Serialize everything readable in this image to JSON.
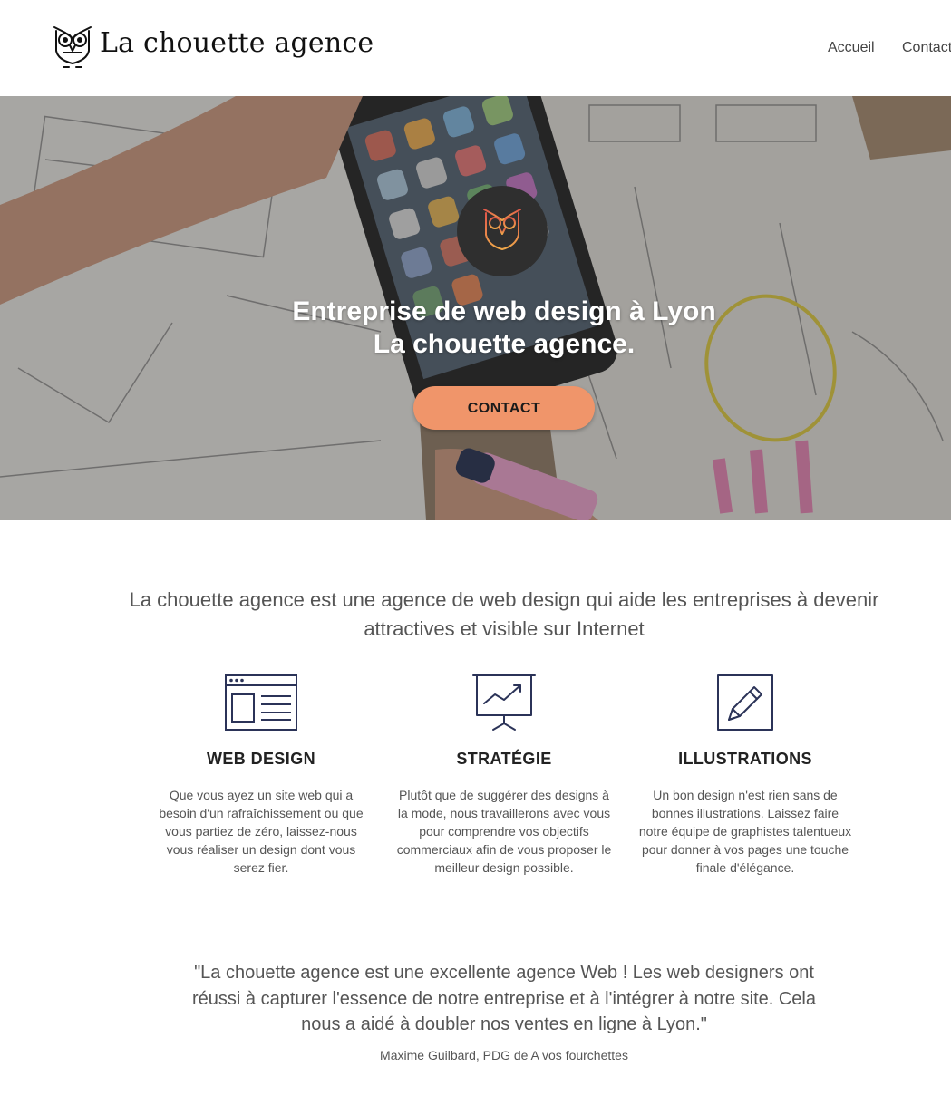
{
  "header": {
    "brand": "La chouette agence",
    "nav": [
      "Accueil",
      "Contact"
    ]
  },
  "hero": {
    "title_line1": "Entreprise de web design à Lyon",
    "title_line2": "La chouette agence.",
    "cta_label": "CONTACT"
  },
  "intro": {
    "text": "La chouette agence est une agence de web design qui aide les entreprises à devenir attractives et visible sur Internet"
  },
  "services": [
    {
      "icon": "browser-window-icon",
      "title": "WEB DESIGN",
      "text": "Que vous ayez un site web qui a besoin d'un rafraîchissement ou que vous partiez de zéro, laissez-nous vous réaliser un design dont vous serez fier."
    },
    {
      "icon": "presentation-chart-icon",
      "title": "STRATÉGIE",
      "text": "Plutôt que de suggérer des designs à la mode, nous travaillerons avec vous pour comprendre vos objectifs commerciaux afin de vous proposer le meilleur design possible."
    },
    {
      "icon": "pencil-square-icon",
      "title": "ILLUSTRATIONS",
      "text": "Un bon design n'est rien sans de bonnes illustrations. Laissez faire notre équipe de graphistes talentueux pour donner à vos pages une touche finale d'élégance."
    }
  ],
  "testimonial": {
    "quote": "\"La chouette agence est une excellente agence Web ! Les web designers ont réussi à capturer l'essence de notre entreprise et à l'intégrer à notre site. Cela nous a aidé à doubler nos ventes en ligne à Lyon.\"",
    "author": "Maxime Guilbard, PDG de A vos fourchettes"
  },
  "colors": {
    "accent": "#f0956a",
    "icon_navy": "#2b3358",
    "text": "#555555"
  }
}
